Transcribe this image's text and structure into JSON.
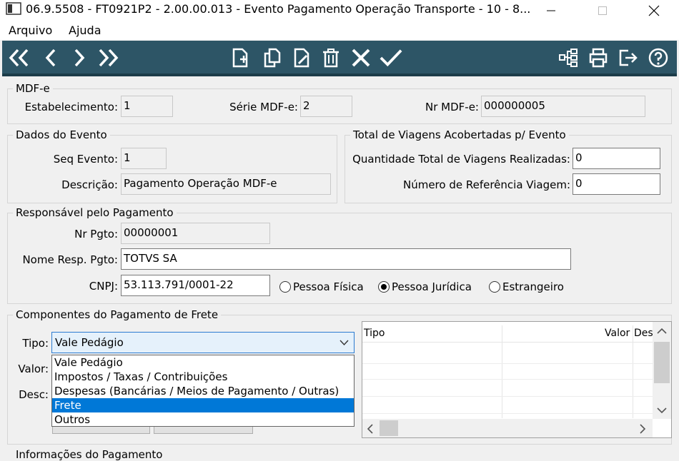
{
  "window": {
    "title": "06.9.5508 - FT0921P2 - 2.00.00.013 - Evento Pagamento Operação Transporte - 10 - 8..."
  },
  "menu": {
    "items": [
      "Arquivo",
      "Ajuda"
    ]
  },
  "mdfe": {
    "legend": "MDF-e",
    "estabelecimento_label": "Estabelecimento:",
    "estabelecimento_value": "1",
    "serie_label": "Série MDF-e:",
    "serie_value": "2",
    "nr_label": "Nr MDF-e:",
    "nr_value": "000000005"
  },
  "evento": {
    "legend": "Dados do Evento",
    "seq_label": "Seq Evento:",
    "seq_value": "1",
    "desc_label": "Descrição:",
    "desc_value": "Pagamento Operação MDF-e"
  },
  "viagens": {
    "legend": "Total de Viagens Acobertadas p/ Evento",
    "qtd_label": "Quantidade Total de Viagens Realizadas:",
    "qtd_value": "0",
    "ref_label": "Número de Referência Viagem:",
    "ref_value": "0"
  },
  "responsavel": {
    "legend": "Responsável pelo Pagamento",
    "nr_label": "Nr Pgto:",
    "nr_value": "00000001",
    "nome_label": "Nome Resp. Pgto:",
    "nome_value": "TOTVS SA",
    "cnpj_label": "CNPJ:",
    "cnpj_value": "53.113.791/0001-22",
    "radios": [
      {
        "label": "Pessoa Física",
        "checked": false
      },
      {
        "label": "Pessoa Jurídica",
        "checked": true
      },
      {
        "label": "Estrangeiro",
        "checked": false
      }
    ]
  },
  "componentes": {
    "legend": "Componentes do Pagamento de Frete",
    "tipo_label": "Tipo:",
    "tipo_value": "Vale Pedágio",
    "valor_label": "Valor:",
    "desc_label": "Desc:",
    "options": [
      "Vale Pedágio",
      "Impostos / Taxas / Contribuições",
      "Despesas (Bancárias / Meios de Pagamento / Outras)",
      "Frete",
      "Outros"
    ],
    "highlighted_option": 3,
    "grid_headers": [
      "Tipo",
      "Valor",
      "Des"
    ]
  },
  "bottom": {
    "partial_legend": "Informações do Pagamento"
  },
  "colors": {
    "toolbar": "#2d5566",
    "selection": "#0078d7"
  }
}
